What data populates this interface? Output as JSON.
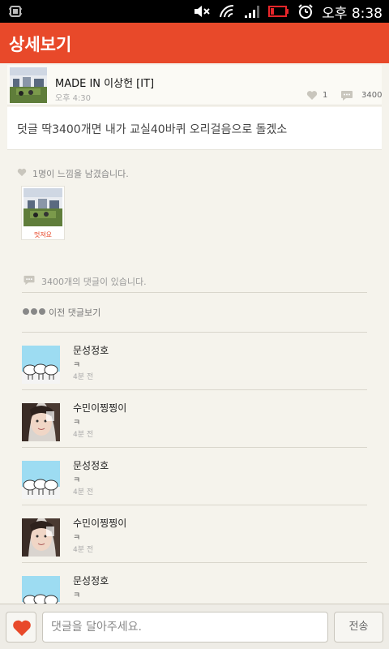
{
  "status_bar": {
    "time": "오후 8:38",
    "icons": [
      "usb-icon",
      "mute-icon",
      "wifi-icon",
      "signal-icon",
      "battery-low-icon",
      "alarm-icon"
    ],
    "battery_color": "#e8262a"
  },
  "header": {
    "title": "상세보기",
    "accent_color": "#e8492a"
  },
  "post": {
    "author": "MADE IN 이상헌 [IT]",
    "time": "오후 4:30",
    "like_count": "1",
    "comment_count": "3400",
    "text": "덧글 딱3400개면 내가 교실40바퀴 오리걸음으로 돌겠소"
  },
  "likes": {
    "summary": "1명이 느낌을 남겼습니다.",
    "users": [
      {
        "reaction": "멋져요"
      }
    ]
  },
  "comments_section": {
    "count_text": "3400개의 댓글이 있습니다.",
    "prev_label": "이전 댓글보기",
    "items": [
      {
        "name": "문성정호",
        "text": "ㅋ",
        "time": "4분 전",
        "avatar": "sheep-avatar"
      },
      {
        "name": "수민이찡찡이",
        "text": "ㅋ",
        "time": "4분 전",
        "avatar": "selfie-avatar"
      },
      {
        "name": "문성정호",
        "text": "ㅋ",
        "time": "4분 전",
        "avatar": "sheep-avatar"
      },
      {
        "name": "수민이찡찡이",
        "text": "ㅋ",
        "time": "4분 전",
        "avatar": "selfie-avatar"
      },
      {
        "name": "문성정호",
        "text": "ㅋ",
        "time": "",
        "avatar": "sheep-avatar"
      }
    ]
  },
  "input_bar": {
    "placeholder": "댓글을 달아주세요.",
    "value": "",
    "send_label": "전송",
    "heart_color": "#e8492a"
  }
}
